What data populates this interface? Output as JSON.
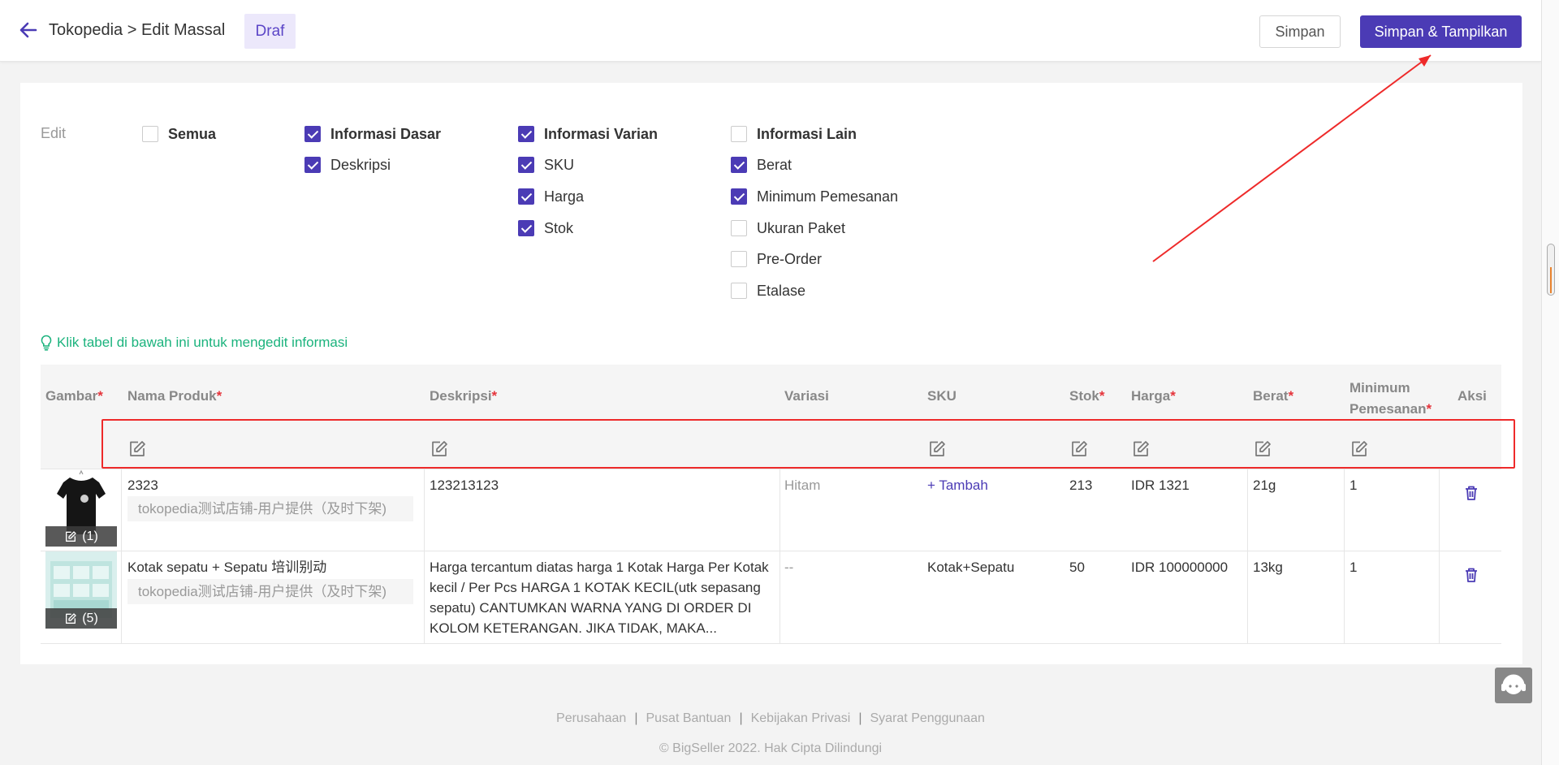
{
  "header": {
    "breadcrumb": "Tokopedia > Edit Massal",
    "status": "Draf",
    "save_label": "Simpan",
    "save_show_label": "Simpan & Tampilkan"
  },
  "edit": {
    "label": "Edit",
    "options": {
      "semua": "Semua",
      "informasi_dasar": "Informasi Dasar",
      "deskripsi": "Deskripsi",
      "informasi_varian": "Informasi Varian",
      "sku": "SKU",
      "harga": "Harga",
      "stok": "Stok",
      "informasi_lain": "Informasi Lain",
      "berat": "Berat",
      "minimum_pemesanan": "Minimum Pemesanan",
      "ukuran_paket": "Ukuran Paket",
      "pre_order": "Pre-Order",
      "etalase": "Etalase"
    },
    "checked": {
      "semua": false,
      "informasi_dasar": true,
      "deskripsi": true,
      "informasi_varian": true,
      "sku": true,
      "harga": true,
      "stok": true,
      "informasi_lain": false,
      "berat": true,
      "minimum_pemesanan": true,
      "ukuran_paket": false,
      "pre_order": false,
      "etalase": false
    }
  },
  "tip": "Klik tabel di bawah ini untuk mengedit informasi",
  "table": {
    "columns": {
      "gambar": "Gambar",
      "nama_produk": "Nama Produk",
      "deskripsi": "Deskripsi",
      "variasi": "Variasi",
      "sku": "SKU",
      "stok": "Stok",
      "harga": "Harga",
      "berat": "Berat",
      "minimum_line1": "Minimum",
      "minimum_line2": "Pemesanan",
      "aksi": "Aksi"
    },
    "required_mark": "*",
    "rows": [
      {
        "image_count": "(1)",
        "name": "2323",
        "store": "tokopedia测试店铺-用户提供（及时下架)",
        "description": "123213123",
        "variation": "Hitam",
        "sku": "+ Tambah",
        "stock": "213",
        "price": "IDR 1321",
        "weight": "21g",
        "min_order": "1"
      },
      {
        "image_count": "(5)",
        "name": "Kotak sepatu + Sepatu 培训别动",
        "store": "tokopedia测试店铺-用户提供（及时下架)",
        "description": "Harga tercantum diatas harga 1 Kotak Harga Per Kotak kecil / Per Pcs HARGA 1 KOTAK KECIL(utk sepasang sepatu) CANTUMKAN WARNA YANG DI ORDER DI KOLOM KETERANGAN. JIKA TIDAK, MAKA...",
        "variation": "--",
        "sku": "Kotak+Sepatu",
        "stock": "50",
        "price": "IDR 100000000",
        "weight": "13kg",
        "min_order": "1"
      }
    ]
  },
  "footer": {
    "links": [
      "Perusahaan",
      "Pusat Bantuan",
      "Kebijakan Privasi",
      "Syarat Penggunaan"
    ],
    "separator": "|",
    "copyright": "© BigSeller 2022. Hak Cipta Dilindungi"
  },
  "colors": {
    "primary": "#4b3bb5",
    "required": "#e5343b",
    "tip": "#1bb37d",
    "annotation": "#ee2a2a"
  }
}
